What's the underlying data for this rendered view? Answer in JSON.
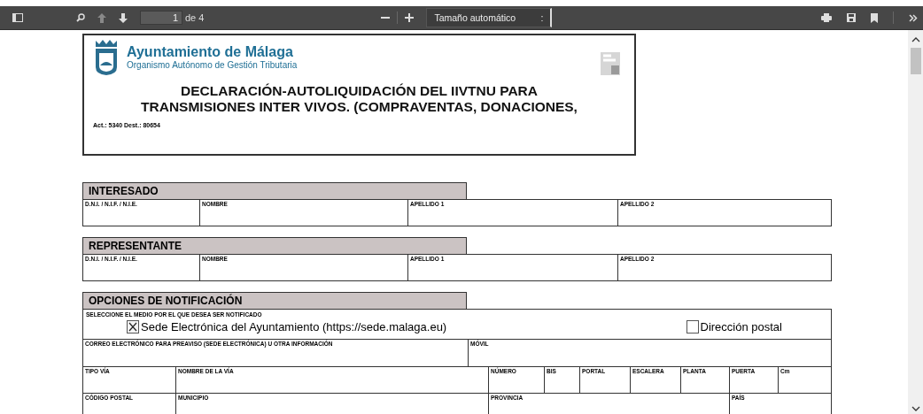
{
  "toolbar": {
    "page_number": "1",
    "page_count": "de 4",
    "zoom": "Tamaño automático",
    "zoom_caret": ":"
  },
  "document": {
    "org_name": "Ayuntamiento de Málaga",
    "org_sub": "Organismo Autónomo de Gestión Tributaria",
    "title_lines": [
      "DECLARACIÓN-AUTOLIQUIDACIÓN DEL IIVTNU PARA",
      "TRANSMISIONES INTER VIVOS. (COMPRAVENTAS, DONACIONES,"
    ],
    "reference": "Act.: 5340  Dest.: 80654",
    "sections": [
      {
        "heading": "INTERESADO",
        "rows": [
          {
            "kind": "persona",
            "fields": [
              "D.N.I. / N.I.F. / N.I.E.",
              "NOMBRE",
              "APELLIDO 1",
              "APELLIDO 2"
            ]
          }
        ]
      },
      {
        "heading": "REPRESENTANTE",
        "rows": [
          {
            "kind": "persona",
            "fields": [
              "D.N.I. / N.I.F. / N.I.E.",
              "NOMBRE",
              "APELLIDO 1",
              "APELLIDO 2"
            ]
          }
        ]
      },
      {
        "heading": "OPCIONES DE NOTIFICACIÓN",
        "rows": [
          {
            "kind": "choice",
            "label": "SELECCIONE EL MEDIO POR EL QUE DESEA SER NOTIFICADO",
            "options": [
              {
                "label": "Sede Electrónica del Ayuntamiento (https://sede.malaga.eu)",
                "checked": true
              },
              {
                "label": "Dirección postal",
                "checked": false
              }
            ]
          },
          {
            "kind": "email",
            "fields": [
              "CORREO ELECTRÓNICO PARA PREAVISO (SEDE ELECTRÓNICA) U OTRA INFORMACIÓN",
              "MÓVIL"
            ]
          },
          {
            "kind": "direccion",
            "fields": [
              "TIPO VÍA",
              "NOMBRE DE LA VÍA",
              "NÚMERO",
              "BIS",
              "PORTAL",
              "ESCALERA",
              "PLANTA",
              "PUERTA",
              "Cm"
            ]
          },
          {
            "kind": "cp",
            "fields": [
              "CÓDIGO POSTAL",
              "MUNICIPIO",
              "PROVINCIA",
              "PAÍS"
            ]
          }
        ]
      }
    ]
  }
}
